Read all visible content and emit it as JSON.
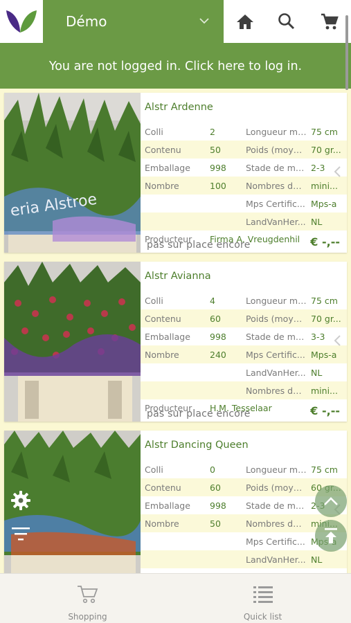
{
  "header": {
    "shop_name": "Démo",
    "login_message": "You are not logged in. Click here to log in."
  },
  "icons": {
    "logo": "leaf-logo",
    "home": "home-icon",
    "search": "search-icon",
    "cart": "cart-icon",
    "dropdown": "chevron-down-icon"
  },
  "products": [
    {
      "title": "Alstr Ardenne",
      "rows": [
        {
          "l1": "Colli",
          "v1": "2",
          "l2": "Longueur mi...",
          "v2": "75 cm"
        },
        {
          "l1": "Contenu",
          "v1": "50",
          "l2": "Poids (moyen)",
          "v2": "70 gr..."
        },
        {
          "l1": "Emballage",
          "v1": "998",
          "l2": "Stade de ma...",
          "v2": "2-3"
        },
        {
          "l1": "Nombre",
          "v1": "100",
          "l2": "Nombres de ...",
          "v2": "mini..."
        },
        {
          "l1": "",
          "v1": "",
          "l2": "Mps Certific...",
          "v2": "Mps-a"
        },
        {
          "l1": "",
          "v1": "",
          "l2": "LandVanHer...",
          "v2": "NL"
        }
      ],
      "producer_label": "Producteur",
      "producer": "Firma A. Vreugdenhil",
      "overlay": "pas sur place encore",
      "price": "€ -,--"
    },
    {
      "title": "Alstr Avianna",
      "rows": [
        {
          "l1": "Colli",
          "v1": "4",
          "l2": "Longueur mi...",
          "v2": "75 cm"
        },
        {
          "l1": "Contenu",
          "v1": "60",
          "l2": "Poids (moyen)",
          "v2": "70 gr..."
        },
        {
          "l1": "Emballage",
          "v1": "998",
          "l2": "Stade de ma...",
          "v2": "3-3"
        },
        {
          "l1": "Nombre",
          "v1": "240",
          "l2": "Mps Certific...",
          "v2": "Mps-a"
        },
        {
          "l1": "",
          "v1": "",
          "l2": "LandVanHer...",
          "v2": "NL"
        },
        {
          "l1": "",
          "v1": "",
          "l2": "Nombres de ...",
          "v2": "mini..."
        }
      ],
      "producer_label": "Producteur",
      "producer": "H.M. Tesselaar",
      "overlay": "pas sur place encore",
      "price": "€ -,--"
    },
    {
      "title": "Alstr Dancing Queen",
      "rows": [
        {
          "l1": "Colli",
          "v1": "0",
          "l2": "Longueur mi...",
          "v2": "75 cm"
        },
        {
          "l1": "Contenu",
          "v1": "60",
          "l2": "Poids (moyen)",
          "v2": "60 gr..."
        },
        {
          "l1": "Emballage",
          "v1": "998",
          "l2": "Stade de ma...",
          "v2": "2-3"
        },
        {
          "l1": "Nombre",
          "v1": "50",
          "l2": "Nombres de ...",
          "v2": "mini..."
        },
        {
          "l1": "",
          "v1": "",
          "l2": "Mps Certific...",
          "v2": "Mps-a"
        },
        {
          "l1": "",
          "v1": "",
          "l2": "LandVanHer...",
          "v2": "NL"
        }
      ],
      "producer_label": "",
      "producer": "",
      "overlay": "",
      "price": ""
    }
  ],
  "floating": {
    "settings_icon": "gear-icon",
    "filter_icon": "filter-icon",
    "scroll_up_icon": "chevron-up-icon",
    "scroll_top_icon": "scroll-to-top-icon"
  },
  "bottom_nav": [
    {
      "label": "Shopping",
      "icon": "cart-icon"
    },
    {
      "label": "Quick list",
      "icon": "list-icon"
    }
  ],
  "colors": {
    "brand_green": "#6b9a45",
    "text_green": "#4d7e2c",
    "background": "#fbf8d3"
  }
}
